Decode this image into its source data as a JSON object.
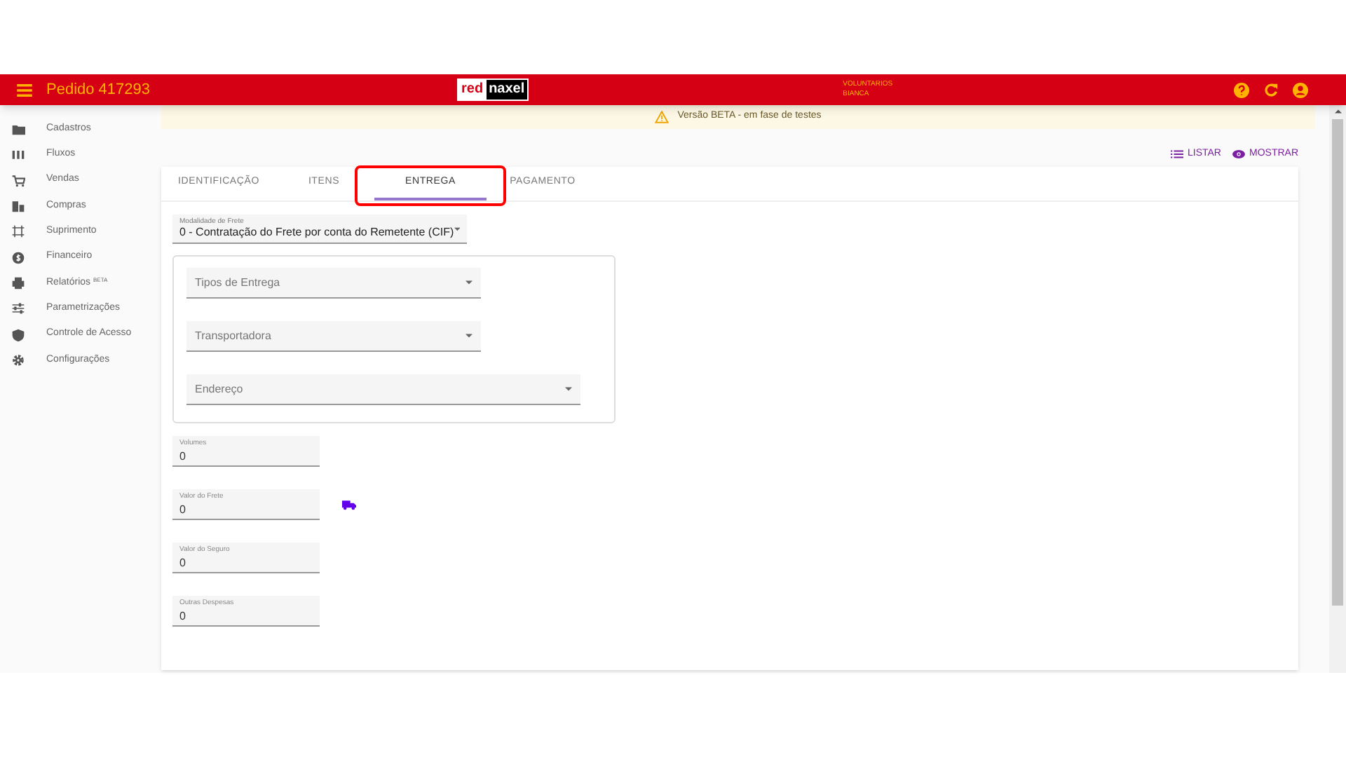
{
  "header": {
    "title": "Pedido 417293",
    "logo": [
      "red",
      "naxel"
    ],
    "user_lines": [
      "VOLUNTARIOS",
      "BIANCA"
    ]
  },
  "sidebar": {
    "items": [
      {
        "label": "Cadastros"
      },
      {
        "label": "Fluxos"
      },
      {
        "label": "Vendas"
      },
      {
        "label": "Compras"
      },
      {
        "label": "Suprimento"
      },
      {
        "label": "Financeiro"
      },
      {
        "label": "Relatórios",
        "badge": "BETA"
      },
      {
        "label": "Parametrizações"
      },
      {
        "label": "Controle de Acesso"
      },
      {
        "label": "Configurações"
      }
    ]
  },
  "banner": "Versão BETA - em fase de testes",
  "actions": [
    {
      "label": "LISTAR"
    },
    {
      "label": "MOSTRAR"
    }
  ],
  "tabs": [
    {
      "label": "IDENTIFICAÇÃO",
      "selected": false,
      "highlighted": false
    },
    {
      "label": "ITENS",
      "selected": false,
      "highlighted": false
    },
    {
      "label": "ENTREGA",
      "selected": true,
      "highlighted": true
    },
    {
      "label": "PAGAMENTO",
      "selected": false,
      "highlighted": false
    }
  ],
  "modalidade": {
    "label": "Modalidade de Frete",
    "value": "0 - Contratação do Frete por conta do Remetente (CIF)"
  },
  "selects": [
    {
      "placeholder": "Tipos de Entrega",
      "wide": false
    },
    {
      "placeholder": "Transportadora",
      "wide": false
    },
    {
      "placeholder": "Endereço",
      "wide": true
    }
  ],
  "fields": [
    {
      "label": "Volumes",
      "value": "0",
      "truck": false
    },
    {
      "label": "Valor do Frete",
      "value": "0",
      "truck": true
    },
    {
      "label": "Valor do Seguro",
      "value": "0",
      "truck": false
    },
    {
      "label": "Outras Despesas",
      "value": "0",
      "truck": false
    }
  ]
}
